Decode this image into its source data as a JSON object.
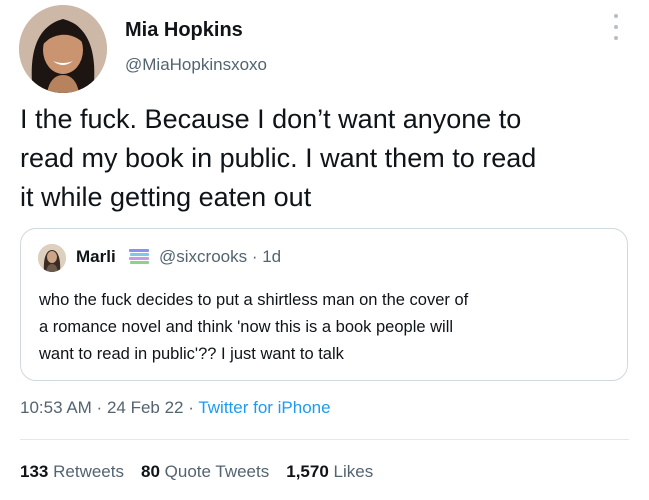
{
  "author": {
    "name": "Mia Hopkins",
    "handle": "@MiaHopkinsxoxo"
  },
  "tweet": {
    "text": "I the fuck. Because I don’t want anyone to\nread my book in public. I want them to read\nit while getting eaten out"
  },
  "quote": {
    "name": "Marli",
    "handle": "@sixcrooks",
    "age": "1d",
    "text": "who the fuck decides to put a shirtless man on the cover of\na romance novel and think 'now this is a book people will\nwant to read in public'?? I just want to talk"
  },
  "meta": {
    "time": "10:53 AM",
    "date": "24 Feb 22",
    "source": "Twitter for iPhone"
  },
  "stats": {
    "retweets_count": "133",
    "retweets_label": "Retweets",
    "quotes_count": "80",
    "quotes_label": "Quote Tweets",
    "likes_count": "1,570",
    "likes_label": "Likes"
  },
  "icons": {
    "more": "more-options-icon",
    "book_stack": "book-stack-icon"
  },
  "colors": {
    "link": "#1d9bf0",
    "secondary_text": "#536471",
    "border": "#cfd9de"
  }
}
